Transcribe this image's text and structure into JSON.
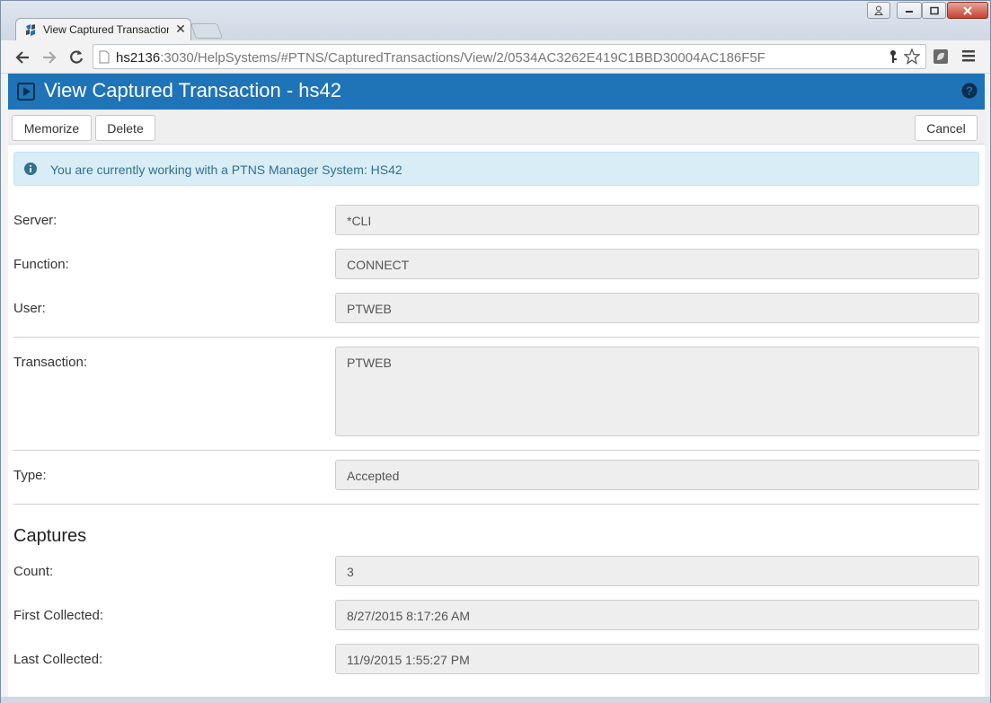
{
  "browser": {
    "tab_title": "View Captured Transaction",
    "url_host": "hs2136",
    "url_rest": ":3030/HelpSystems/#PTNS/CapturedTransactions/View/2/0534AC3262E419C1BBD30004AC186F5F"
  },
  "header": {
    "title": "View Captured Transaction - hs42",
    "accent": "#1f73b7"
  },
  "toolbar": {
    "memorize_label": "Memorize",
    "delete_label": "Delete",
    "cancel_label": "Cancel"
  },
  "alert": {
    "message": "You are currently working with a PTNS Manager System: HS42"
  },
  "fields": {
    "server": {
      "label": "Server:",
      "value": "*CLI"
    },
    "function": {
      "label": "Function:",
      "value": "CONNECT"
    },
    "user": {
      "label": "User:",
      "value": "PTWEB"
    },
    "transaction": {
      "label": "Transaction:",
      "value": "PTWEB"
    },
    "type": {
      "label": "Type:",
      "value": "Accepted"
    }
  },
  "captures": {
    "heading": "Captures",
    "count": {
      "label": "Count:",
      "value": "3"
    },
    "first": {
      "label": "First Collected:",
      "value": "8/27/2015 8:17:26 AM"
    },
    "last": {
      "label": "Last Collected:",
      "value": "11/9/2015 1:55:27 PM"
    }
  }
}
